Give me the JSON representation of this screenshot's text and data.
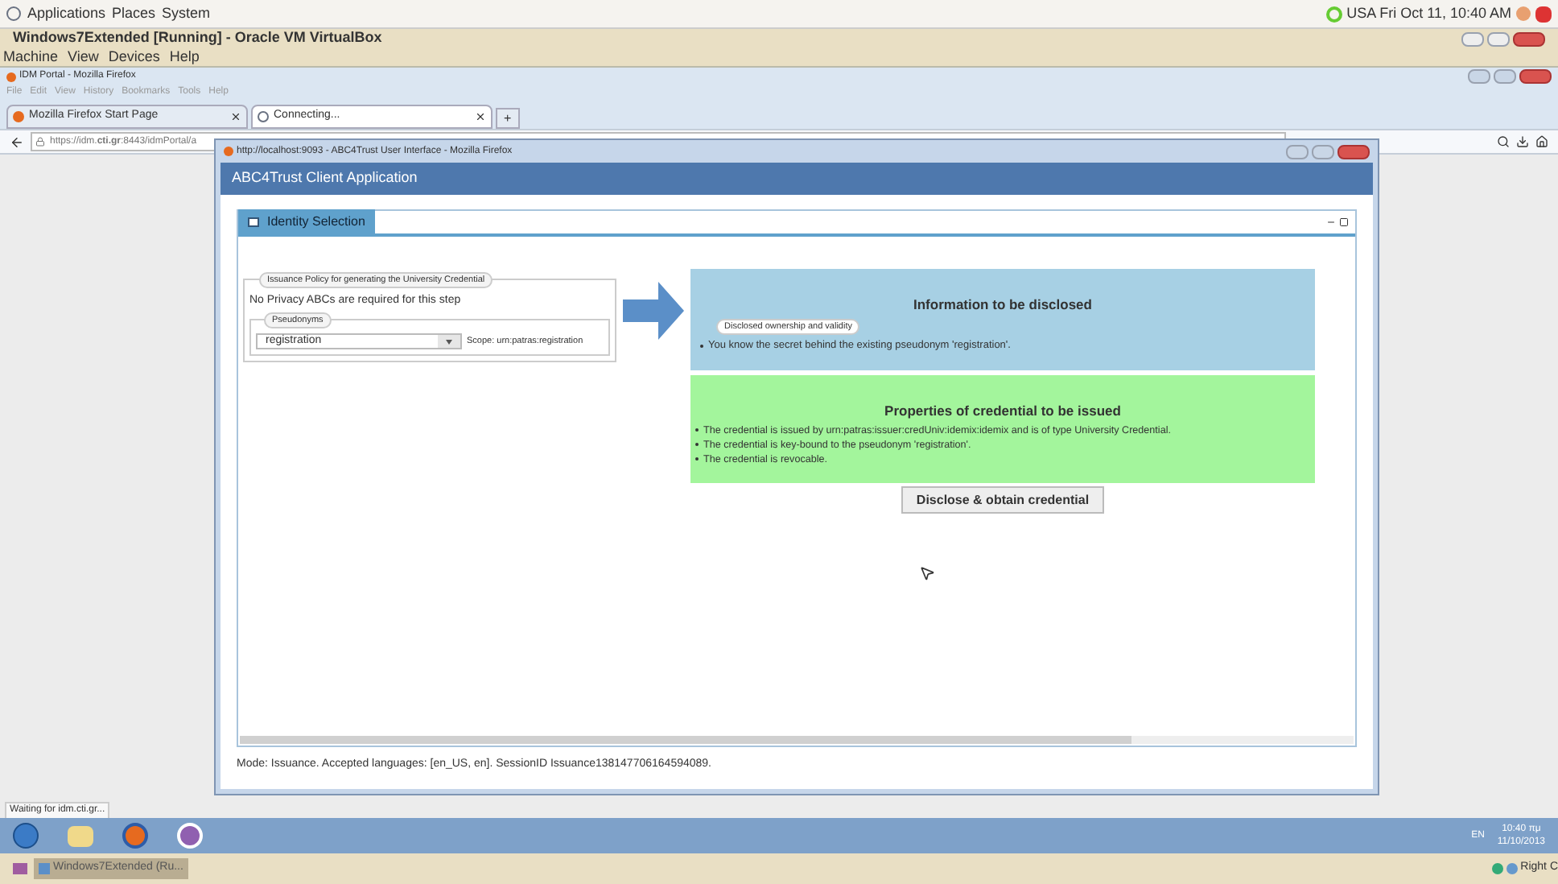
{
  "top_panel": {
    "menus": [
      "Applications",
      "Places",
      "System"
    ],
    "clock": "USA Fri Oct 11, 10:40 AM"
  },
  "vbox": {
    "title": "Windows7Extended [Running] - Oracle VM VirtualBox",
    "menus": [
      "Machine",
      "View",
      "Devices",
      "Help"
    ]
  },
  "firefox": {
    "title": "IDM Portal - Mozilla Firefox",
    "menus": [
      "File",
      "Edit",
      "View",
      "History",
      "Bookmarks",
      "Tools",
      "Help"
    ],
    "tabs": [
      {
        "label": "Mozilla Firefox Start Page",
        "selected": false
      },
      {
        "label": "Connecting...",
        "selected": true
      }
    ],
    "new_tab": "+",
    "url": "https://idm.**cti.gr**:8443/idmPortal/a",
    "status": "Waiting for idm.cti.gr..."
  },
  "popup": {
    "title": "http://localhost:9093 - ABC4Trust User Interface - Mozilla Firefox",
    "header": "ABC4Trust Client Application",
    "tabs": [
      {
        "label": "Identity Selection",
        "selected": true
      }
    ],
    "policy": {
      "legend": "Issuance Policy for generating the University Credential",
      "text": "No Privacy ABCs are required for this step",
      "pseudonyms": {
        "legend": "Pseudonyms",
        "value": "registration",
        "scope": "Scope: urn:patras:registration"
      }
    },
    "disclosed": {
      "title": "Information to be disclosed",
      "legend": "Disclosed ownership and validity",
      "items": [
        "You know the secret behind the existing pseudonym 'registration'."
      ]
    },
    "issued": {
      "title": "Properties of credential to be issued",
      "items": [
        "The credential is issued by urn:patras:issuer:credUniv:idemix:idemix and is of type University Credential.",
        "The credential is key-bound to the pseudonym 'registration'.",
        "The credential is revocable."
      ]
    },
    "button": "Disclose & obtain credential",
    "status": "Mode: Issuance. Accepted languages: [en_US, en]. SessionID Issuance138147706164594089."
  },
  "taskbar": {
    "language": "EN",
    "time": "10:40 πμ",
    "date": "11/10/2013"
  },
  "bottom_panel": {
    "task": "Windows7Extended (Ru...",
    "tray_text": "Right C"
  }
}
